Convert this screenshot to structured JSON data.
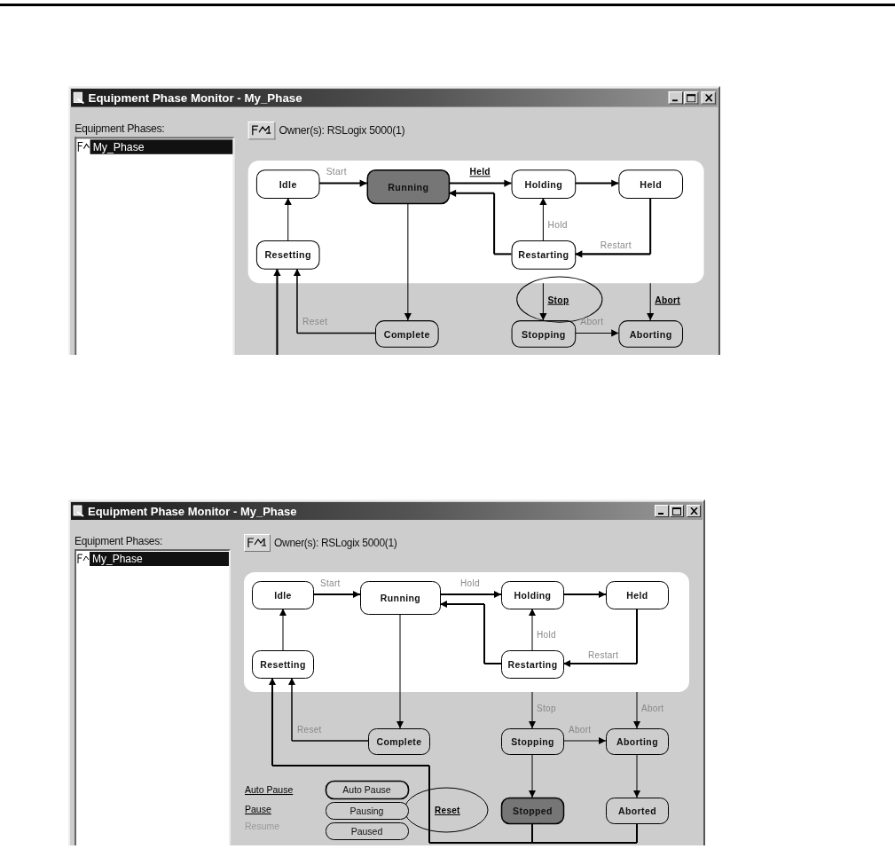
{
  "windows": [
    {
      "title": "Equipment Phase Monitor - My_Phase",
      "phases_label": "Equipment Phases:",
      "phases": [
        {
          "name": "My_Phase",
          "selected": true
        }
      ],
      "owner": "Owner(s): RSLogix 5000(1)",
      "states": [
        {
          "name": "Idle",
          "active": false
        },
        {
          "name": "Running",
          "active": true
        },
        {
          "name": "Holding",
          "active": false
        },
        {
          "name": "Held",
          "active": false
        },
        {
          "name": "Resetting",
          "active": false
        },
        {
          "name": "Restarting",
          "active": false
        },
        {
          "name": "Complete",
          "active": false
        },
        {
          "name": "Stopping",
          "active": false
        },
        {
          "name": "Aborting",
          "active": false
        }
      ],
      "commands": [
        {
          "label": "Start",
          "enabled": false,
          "circled": false
        },
        {
          "label": "Held",
          "enabled": true,
          "circled": false
        },
        {
          "label": "Hold",
          "enabled": false,
          "circled": false
        },
        {
          "label": "Restart",
          "enabled": false,
          "circled": false
        },
        {
          "label": "Reset",
          "enabled": false,
          "circled": false
        },
        {
          "label": "Stop",
          "enabled": true,
          "circled": true
        },
        {
          "label": "Abort",
          "enabled": false,
          "circled": false
        },
        {
          "label": "Abort",
          "enabled": true,
          "circled": false
        }
      ]
    },
    {
      "title": "Equipment Phase Monitor - My_Phase",
      "phases_label": "Equipment Phases:",
      "phases": [
        {
          "name": "My_Phase",
          "selected": true
        }
      ],
      "owner": "Owner(s): RSLogix 5000(1)",
      "states": [
        {
          "name": "Idle",
          "active": false
        },
        {
          "name": "Running",
          "active": false
        },
        {
          "name": "Holding",
          "active": false
        },
        {
          "name": "Held",
          "active": false
        },
        {
          "name": "Resetting",
          "active": false
        },
        {
          "name": "Restarting",
          "active": false
        },
        {
          "name": "Complete",
          "active": false
        },
        {
          "name": "Stopping",
          "active": false
        },
        {
          "name": "Aborting",
          "active": false
        },
        {
          "name": "Stopped",
          "active": true
        },
        {
          "name": "Aborted",
          "active": false
        }
      ],
      "commands": [
        {
          "label": "Start",
          "enabled": false,
          "circled": false
        },
        {
          "label": "Hold",
          "enabled": false,
          "circled": false
        },
        {
          "label": "Hold",
          "enabled": false,
          "circled": false
        },
        {
          "label": "Restart",
          "enabled": false,
          "circled": false
        },
        {
          "label": "Reset",
          "enabled": false,
          "circled": false
        },
        {
          "label": "Stop",
          "enabled": false,
          "circled": false
        },
        {
          "label": "Abort",
          "enabled": false,
          "circled": false
        },
        {
          "label": "Abort",
          "enabled": false,
          "circled": false
        },
        {
          "label": "Reset",
          "enabled": true,
          "circled": true
        }
      ],
      "pause_commands": [
        {
          "label": "Auto Pause",
          "enabled": true
        },
        {
          "label": "Pause",
          "enabled": true
        },
        {
          "label": "Resume",
          "enabled": false
        }
      ],
      "pause_states": [
        {
          "name": "Auto Pause"
        },
        {
          "name": "Pausing"
        },
        {
          "name": "Paused"
        }
      ]
    }
  ]
}
